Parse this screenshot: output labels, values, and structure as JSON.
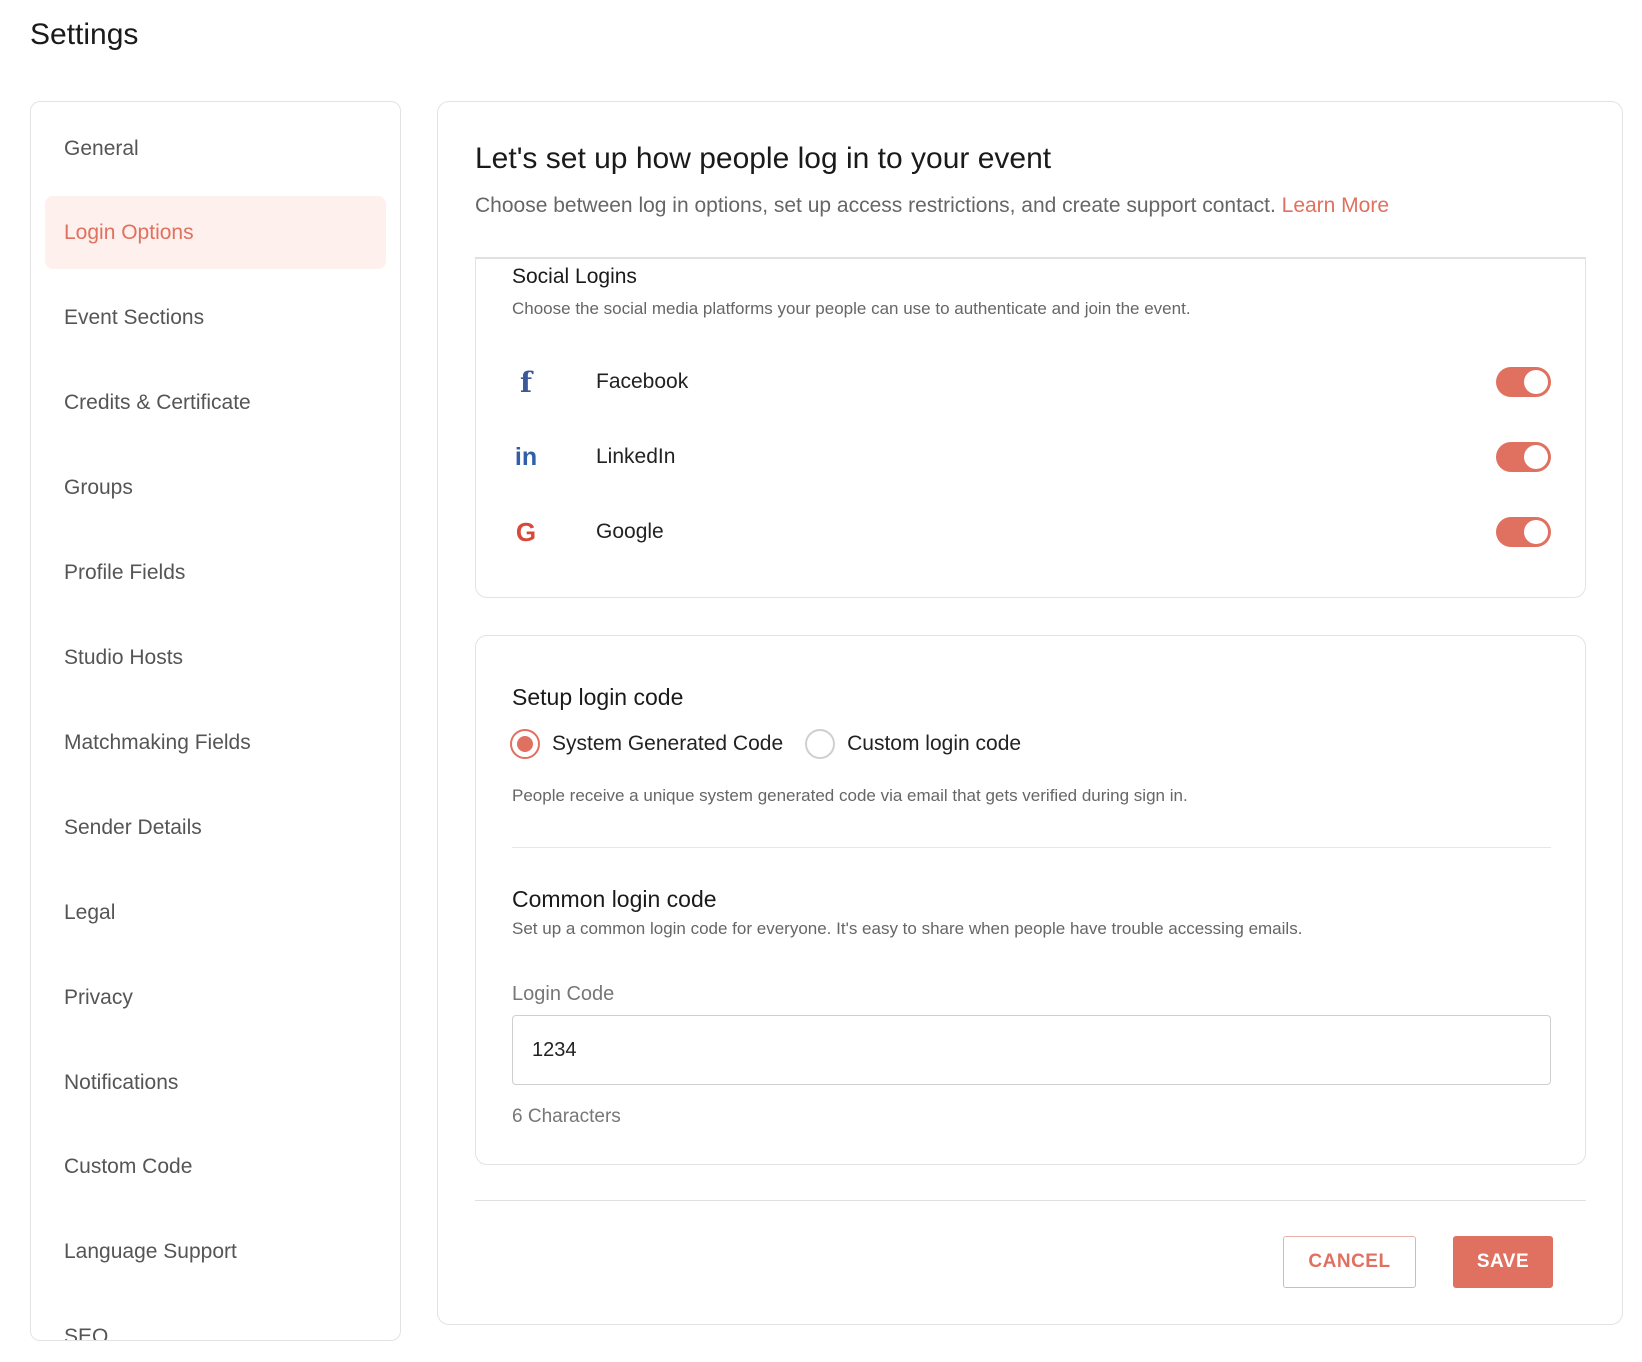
{
  "page": {
    "title": "Settings"
  },
  "sidebar": {
    "items": [
      {
        "label": "General"
      },
      {
        "label": "Login Options"
      },
      {
        "label": "Event Sections"
      },
      {
        "label": "Credits & Certificate"
      },
      {
        "label": "Groups"
      },
      {
        "label": "Profile Fields"
      },
      {
        "label": "Studio Hosts"
      },
      {
        "label": "Matchmaking Fields"
      },
      {
        "label": "Sender Details"
      },
      {
        "label": "Legal"
      },
      {
        "label": "Privacy"
      },
      {
        "label": "Notifications"
      },
      {
        "label": "Custom Code"
      },
      {
        "label": "Language Support"
      },
      {
        "label": "SEO"
      }
    ],
    "active": "Login Options"
  },
  "main": {
    "heading": "Let's set up how people log in to your event",
    "subheading": "Choose between log in options, set up access restrictions, and create support contact.",
    "learn_more": "Learn More"
  },
  "social": {
    "title": "Social Logins",
    "description": "Choose the social media platforms your people can use to authenticate and join the event.",
    "platforms": [
      {
        "label": "Facebook",
        "icon": "facebook-icon",
        "glyph": "f",
        "enabled": true
      },
      {
        "label": "LinkedIn",
        "icon": "linkedin-icon",
        "glyph": "in",
        "enabled": true
      },
      {
        "label": "Google",
        "icon": "google-icon",
        "glyph": "G",
        "enabled": true
      }
    ]
  },
  "login_code": {
    "title": "Setup login code",
    "options": [
      {
        "label": "System Generated Code",
        "selected": true
      },
      {
        "label": "Custom login code",
        "selected": false
      }
    ],
    "description": "People receive a unique system generated code via email that gets verified during sign in."
  },
  "common_code": {
    "title": "Common login code",
    "description": "Set up a common login code for everyone. It's easy to share when people have trouble accessing emails.",
    "field_label": "Login Code",
    "value": "1234",
    "helper": "6 Characters"
  },
  "actions": {
    "cancel": "CANCEL",
    "save": "SAVE"
  },
  "colors": {
    "accent": "#e0705f",
    "active_bg": "#fdf0ed",
    "facebook": "#3b5998",
    "linkedin": "#2e5fa8",
    "google": "#d9493a"
  }
}
